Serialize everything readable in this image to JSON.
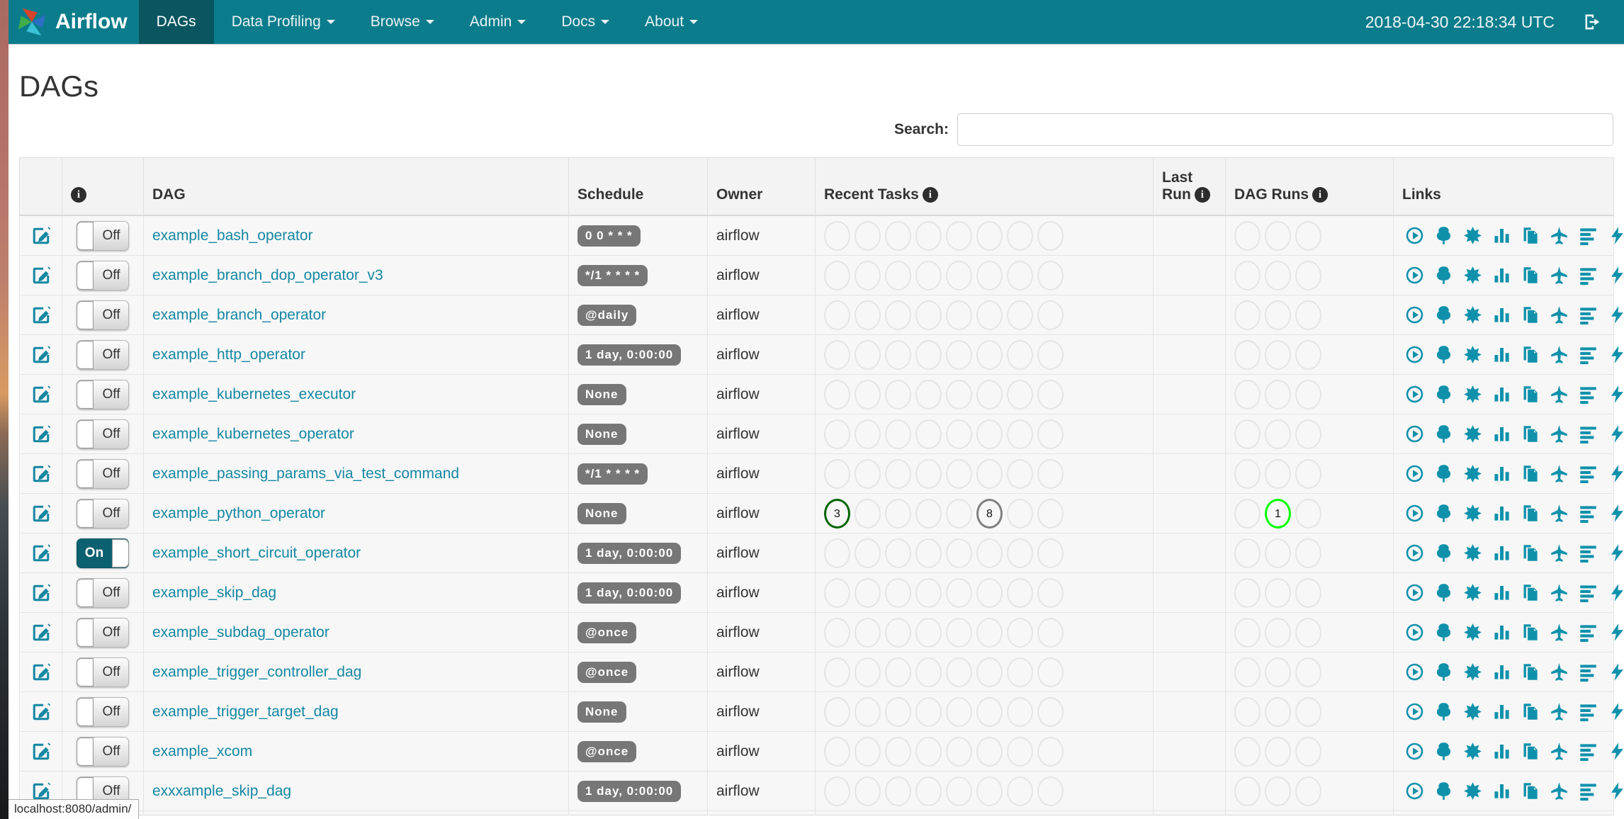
{
  "navbar": {
    "brand": "Airflow",
    "items": [
      {
        "label": "DAGs",
        "active": true,
        "caret": false
      },
      {
        "label": "Data Profiling",
        "active": false,
        "caret": true
      },
      {
        "label": "Browse",
        "active": false,
        "caret": true
      },
      {
        "label": "Admin",
        "active": false,
        "caret": true
      },
      {
        "label": "Docs",
        "active": false,
        "caret": true
      },
      {
        "label": "About",
        "active": false,
        "caret": true
      }
    ],
    "clock": "2018-04-30 22:18:34 UTC",
    "logout_icon": "sign-out-icon"
  },
  "page": {
    "title": "DAGs"
  },
  "search": {
    "label": "Search:",
    "value": "",
    "placeholder": ""
  },
  "status_colors": {
    "success": "#006400",
    "queued": "#808080",
    "running": "#00ff00"
  },
  "table": {
    "headers": [
      {
        "label": ""
      },
      {
        "label": "",
        "info": true
      },
      {
        "label": "DAG"
      },
      {
        "label": "Schedule"
      },
      {
        "label": "Owner"
      },
      {
        "label": "Recent Tasks",
        "info": true
      },
      {
        "label": "Last Run",
        "info": true
      },
      {
        "label": "DAG Runs",
        "info": true
      },
      {
        "label": "Links"
      }
    ],
    "recent_task_slots": 8,
    "dag_run_slots": 3,
    "link_icons": [
      "trigger-dag",
      "tree-view",
      "graph-view",
      "task-duration",
      "task-tries",
      "landing-times",
      "gantt",
      "code",
      "logs",
      "refresh"
    ],
    "rows": [
      {
        "dag_id": "example_bash_operator",
        "toggle": "Off",
        "schedule": "0 0 * * *",
        "owner": "airflow",
        "last_run": "",
        "recent_tasks": [],
        "dag_runs": []
      },
      {
        "dag_id": "example_branch_dop_operator_v3",
        "toggle": "Off",
        "schedule": "*/1 * * * *",
        "owner": "airflow",
        "last_run": "",
        "recent_tasks": [],
        "dag_runs": []
      },
      {
        "dag_id": "example_branch_operator",
        "toggle": "Off",
        "schedule": "@daily",
        "owner": "airflow",
        "last_run": "",
        "recent_tasks": [],
        "dag_runs": []
      },
      {
        "dag_id": "example_http_operator",
        "toggle": "Off",
        "schedule": "1 day, 0:00:00",
        "owner": "airflow",
        "last_run": "",
        "recent_tasks": [],
        "dag_runs": []
      },
      {
        "dag_id": "example_kubernetes_executor",
        "toggle": "Off",
        "schedule": "None",
        "owner": "airflow",
        "last_run": "",
        "recent_tasks": [],
        "dag_runs": []
      },
      {
        "dag_id": "example_kubernetes_operator",
        "toggle": "Off",
        "schedule": "None",
        "owner": "airflow",
        "last_run": "",
        "recent_tasks": [],
        "dag_runs": []
      },
      {
        "dag_id": "example_passing_params_via_test_command",
        "toggle": "Off",
        "schedule": "*/1 * * * *",
        "owner": "airflow",
        "last_run": "",
        "recent_tasks": [],
        "dag_runs": []
      },
      {
        "dag_id": "example_python_operator",
        "toggle": "Off",
        "schedule": "None",
        "owner": "airflow",
        "last_run": "",
        "recent_tasks": [
          {
            "slot": 0,
            "count": "3",
            "status": "success"
          },
          {
            "slot": 5,
            "count": "8",
            "status": "queued"
          }
        ],
        "dag_runs": [
          {
            "slot": 1,
            "count": "1",
            "status": "running"
          }
        ]
      },
      {
        "dag_id": "example_short_circuit_operator",
        "toggle": "On",
        "schedule": "1 day, 0:00:00",
        "owner": "airflow",
        "last_run": "",
        "recent_tasks": [],
        "dag_runs": []
      },
      {
        "dag_id": "example_skip_dag",
        "toggle": "Off",
        "schedule": "1 day, 0:00:00",
        "owner": "airflow",
        "last_run": "",
        "recent_tasks": [],
        "dag_runs": []
      },
      {
        "dag_id": "example_subdag_operator",
        "toggle": "Off",
        "schedule": "@once",
        "owner": "airflow",
        "last_run": "",
        "recent_tasks": [],
        "dag_runs": []
      },
      {
        "dag_id": "example_trigger_controller_dag",
        "toggle": "Off",
        "schedule": "@once",
        "owner": "airflow",
        "last_run": "",
        "recent_tasks": [],
        "dag_runs": []
      },
      {
        "dag_id": "example_trigger_target_dag",
        "toggle": "Off",
        "schedule": "None",
        "owner": "airflow",
        "last_run": "",
        "recent_tasks": [],
        "dag_runs": []
      },
      {
        "dag_id": "example_xcom",
        "toggle": "Off",
        "schedule": "@once",
        "owner": "airflow",
        "last_run": "",
        "recent_tasks": [],
        "dag_runs": []
      },
      {
        "dag_id": "exxxample_skip_dag",
        "toggle": "Off",
        "schedule": "1 day, 0:00:00",
        "owner": "airflow",
        "last_run": "",
        "recent_tasks": [],
        "dag_runs": []
      }
    ]
  },
  "status_bar": {
    "text": "localhost:8080/admin/"
  }
}
